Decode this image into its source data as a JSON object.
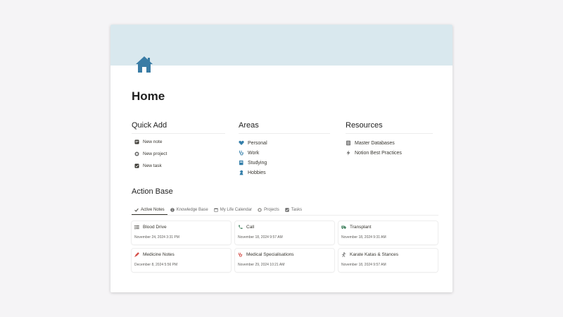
{
  "colors": {
    "cover": "#d9e8ee",
    "page_icon": "#3a7ca5",
    "accent": "#337ea9",
    "red": "#d44c47",
    "green": "#448361",
    "orange": "#cb7b37"
  },
  "page": {
    "title": "Home",
    "icon": "house-icon"
  },
  "quick_add": {
    "heading": "Quick Add",
    "items": [
      {
        "label": "New note",
        "icon": "note-icon"
      },
      {
        "label": "New project",
        "icon": "project-icon"
      },
      {
        "label": "New task",
        "icon": "checkbox-icon"
      }
    ]
  },
  "areas": {
    "heading": "Areas",
    "items": [
      {
        "label": "Personal",
        "icon": "heart-icon"
      },
      {
        "label": "Work",
        "icon": "stethoscope-icon"
      },
      {
        "label": "Studying",
        "icon": "book-icon"
      },
      {
        "label": "Hobbies",
        "icon": "chess-knight-icon"
      }
    ]
  },
  "resources": {
    "heading": "Resources",
    "items": [
      {
        "label": "Master Databases",
        "icon": "database-icon"
      },
      {
        "label": "Notion Best Practices",
        "icon": "lightning-icon"
      }
    ]
  },
  "action_base": {
    "heading": "Action Base",
    "tabs": [
      {
        "label": "Active Notes",
        "icon": "check-icon",
        "active": true
      },
      {
        "label": "Knowledge Base",
        "icon": "info-icon"
      },
      {
        "label": "My Life Calendar",
        "icon": "calendar-icon"
      },
      {
        "label": "Projects",
        "icon": "project-icon"
      },
      {
        "label": "Tasks",
        "icon": "checkbox-icon"
      }
    ],
    "cards": [
      {
        "title": "Blood Drive",
        "date": "November 24, 2024 3:31 PM",
        "icon": "list-icon"
      },
      {
        "title": "Call",
        "date": "November 18, 2024 9:57 AM",
        "icon": "phone-icon"
      },
      {
        "title": "Transplant",
        "date": "November 18, 2024 9:31 AM",
        "icon": "ambulance-icon"
      },
      {
        "title": "Medicine Notes",
        "date": "December 8, 2024 5:56 PM",
        "icon": "syringe-icon"
      },
      {
        "title": "Medical Specialisations",
        "date": "November 29, 2024 10:21 AM",
        "icon": "stethoscope-icon"
      },
      {
        "title": "Karate Katas & Stances",
        "date": "November 18, 2024 9:57 AM",
        "icon": "karate-icon"
      }
    ]
  }
}
